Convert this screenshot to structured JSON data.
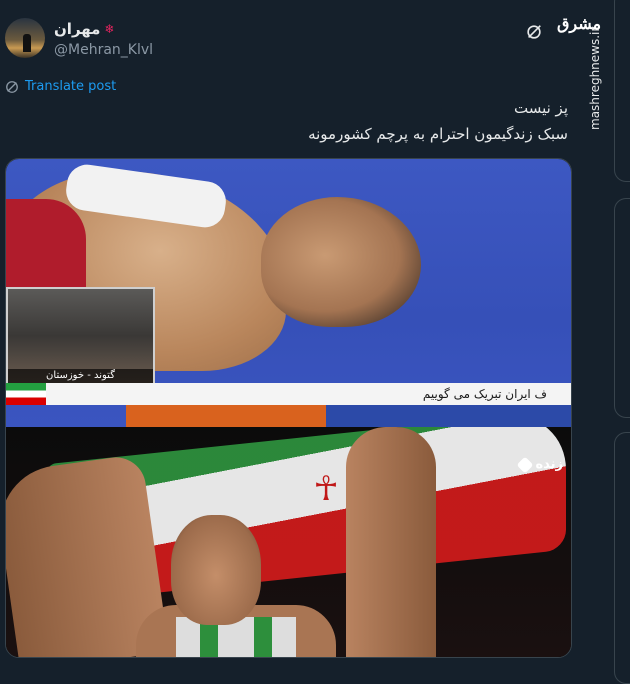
{
  "post": {
    "display_name": "مهران",
    "handle": "@Mehran_Klvl",
    "translate_label": "Translate post",
    "text_line1": "پز نیست",
    "text_line2": "سبک زندگیمون احترام به پرچم کشورمونه"
  },
  "overlay": {
    "logo_text": "مشرق",
    "watermark": "mashreghnews.ir"
  },
  "media": {
    "inset_label": "گتوند - خوزستان",
    "ticker_text": "ف ایران تبریک می گوییم",
    "live_label": "زنده"
  },
  "colors": {
    "background": "#15202b",
    "link": "#1d9bf0",
    "secondary_text": "#8b98a5"
  },
  "icons": {
    "flag_emoji": "maple-leaf-icon",
    "translate": "globe-icon",
    "grok": "grok-icon"
  }
}
